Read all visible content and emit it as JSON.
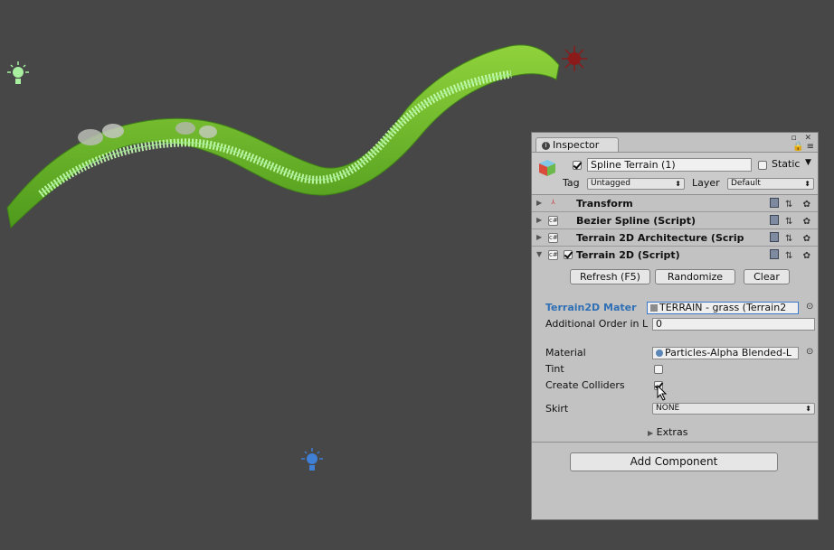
{
  "inspector": {
    "tab_label": "Inspector",
    "window_controls": "▫ ✕",
    "lock_menu": "🔒 ≡",
    "header": {
      "active": true,
      "object_name": "Spline Terrain (1)",
      "static_label": "Static",
      "static_checked": false,
      "tag_label": "Tag",
      "tag_value": "Untagged",
      "layer_label": "Layer",
      "layer_value": "Default"
    },
    "components": [
      {
        "title": "Transform",
        "expanded": false
      },
      {
        "title": "Bezier Spline (Script)",
        "expanded": false
      },
      {
        "title": "Terrain 2D Architecture (Scrip",
        "expanded": false
      },
      {
        "title": "Terrain 2D (Script)",
        "expanded": true,
        "enabled": true
      }
    ],
    "terrain2d": {
      "buttons": {
        "refresh": "Refresh (F5)",
        "randomize": "Randomize",
        "clear": "Clear"
      },
      "material_label": "Terrain2D Mater",
      "material_value": "TERRAIN - grass (Terrain2",
      "order_label": "Additional Order in L",
      "order_value": "0",
      "mat_label": "Material",
      "mat_value": "Particles-Alpha Blended-L",
      "tint_label": "Tint",
      "tint_checked": false,
      "colliders_label": "Create Colliders",
      "colliders_checked": true,
      "skirt_label": "Skirt",
      "skirt_value": "NONE",
      "extras_label": "Extras"
    },
    "add_component": "Add Component"
  },
  "scene": {
    "colors": {
      "background": "#474747",
      "grass": "#6fb52c",
      "spline": "#c8ffb4",
      "light_green": "#a8f0a0",
      "light_red": "#8b1a1a",
      "light_blue": "#3f7fd6"
    }
  }
}
